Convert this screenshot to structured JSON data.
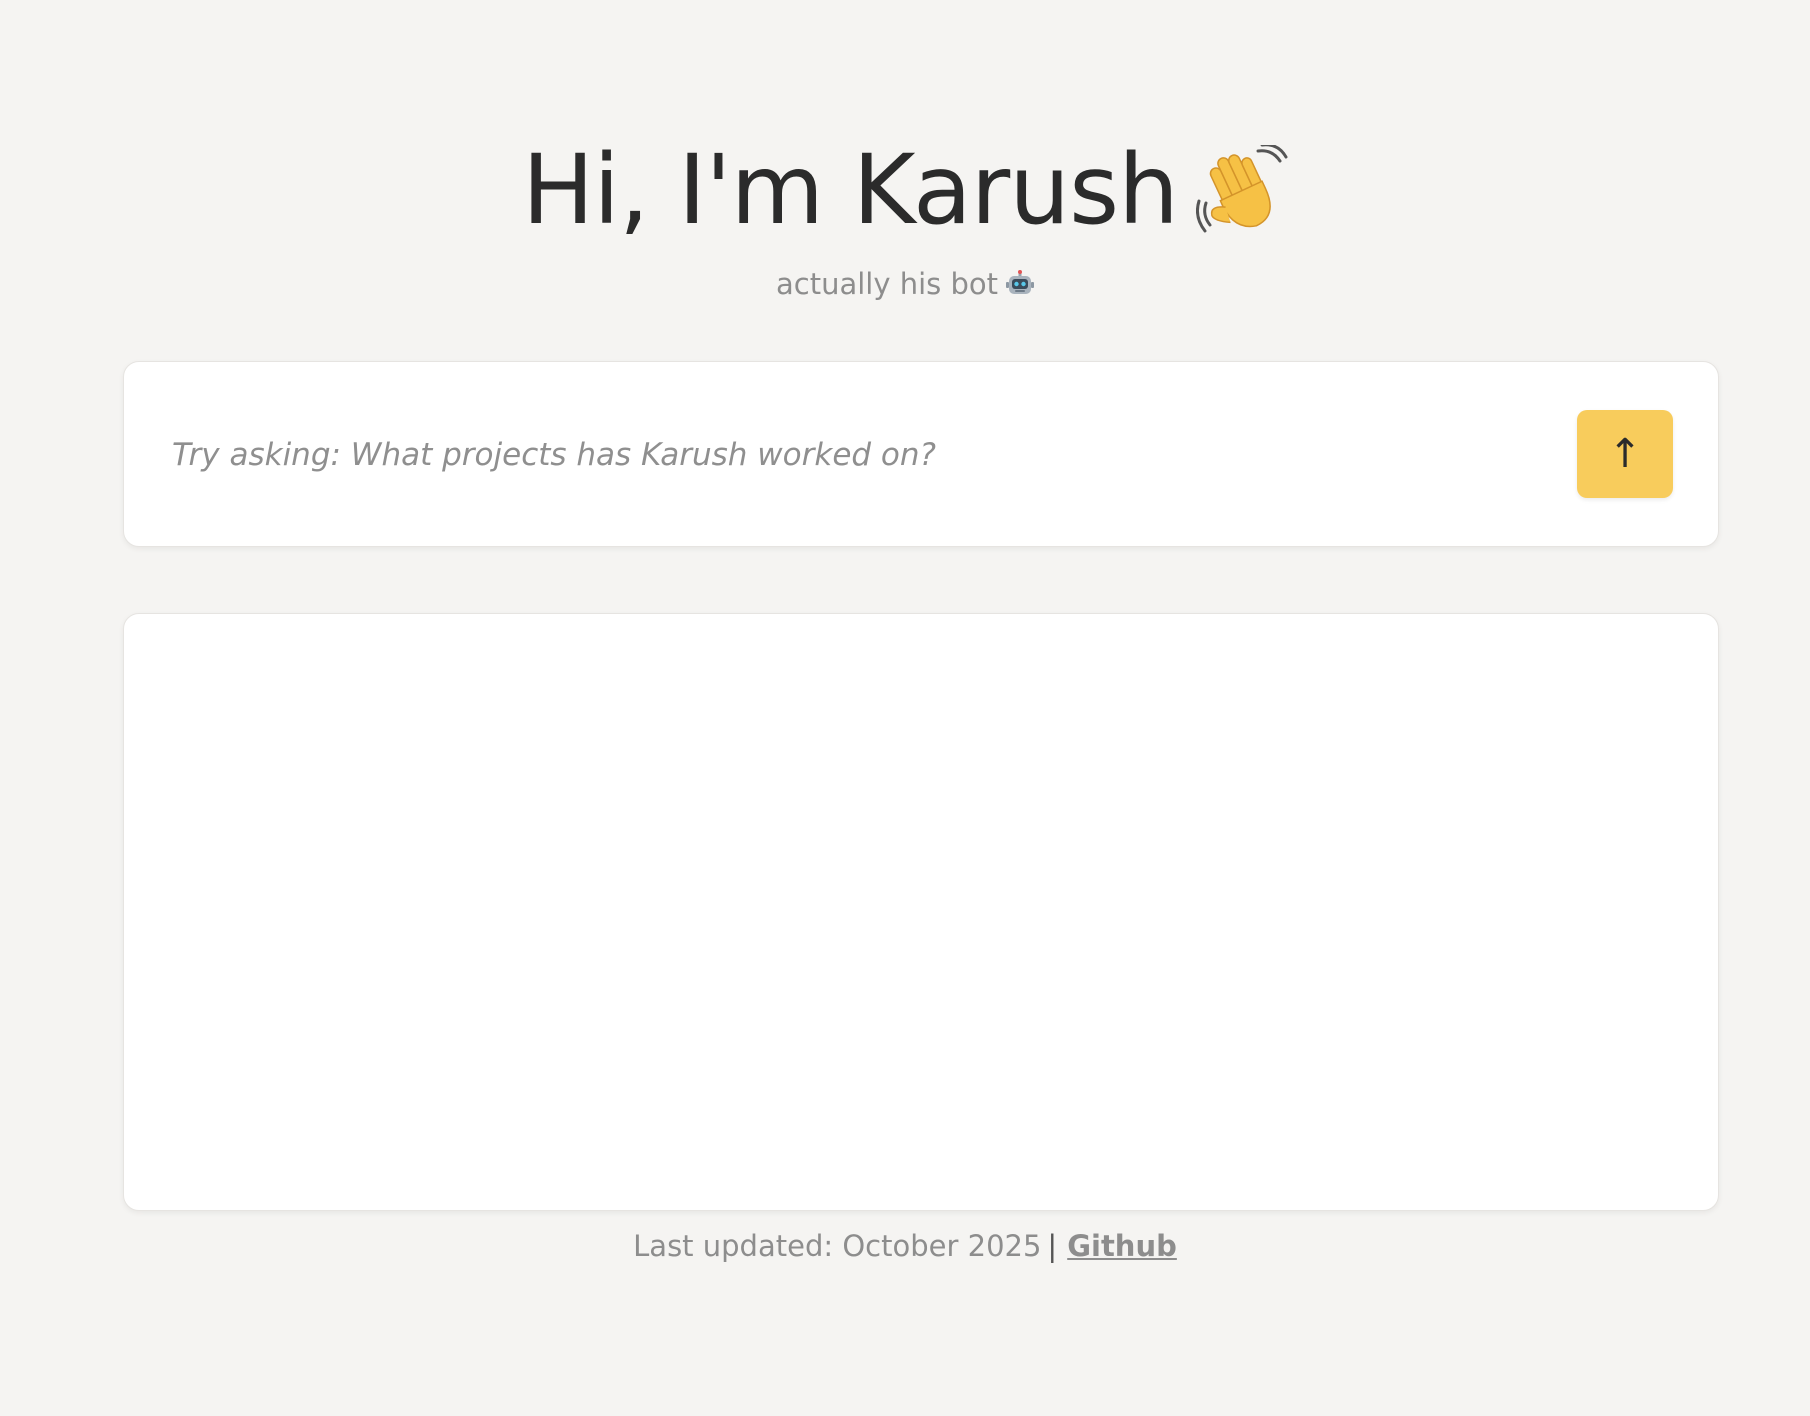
{
  "hero": {
    "title": "Hi, I'm Karush",
    "title_icon": "waving-hand-icon",
    "subtitle": "actually his bot",
    "subtitle_icon": "robot-icon"
  },
  "ask": {
    "placeholder": "Try asking: What projects has Karush worked on?",
    "value": "",
    "send_label": "↑",
    "send_icon": "arrow-up-icon"
  },
  "response": {
    "content": ""
  },
  "footer": {
    "last_updated": "Last updated: October 2025",
    "separator": "|",
    "github_label": "Github"
  },
  "colors": {
    "background": "#f5f4f2",
    "card": "#ffffff",
    "accent": "#f8cc5c",
    "title_text": "#2b2b2b",
    "muted_text": "#8d8d8d"
  }
}
